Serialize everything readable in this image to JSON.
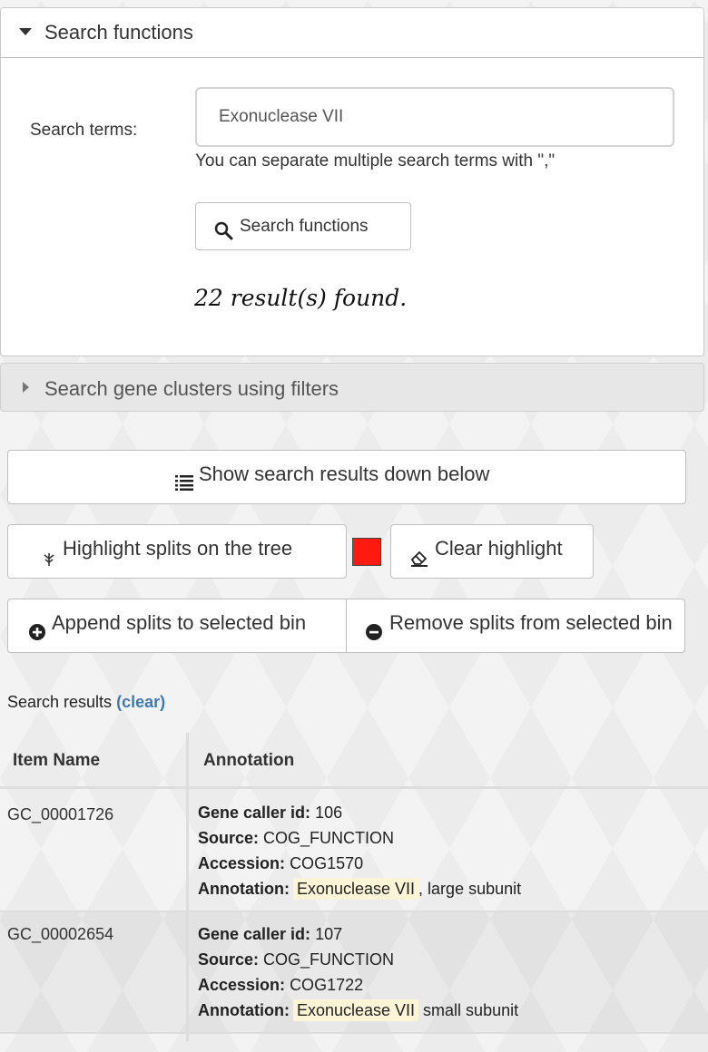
{
  "search_functions": {
    "title": "Search functions",
    "terms_label": "Search terms:",
    "terms_value": "Exonuclease VII",
    "hint": "You can separate multiple search terms with \",\"",
    "button_label": "Search functions",
    "results_found": "22 result(s) found."
  },
  "gene_clusters_panel": {
    "title": "Search gene clusters using filters"
  },
  "actions": {
    "show_results": "Show search results down below",
    "highlight_splits": "Highlight splits on the tree",
    "highlight_color": "#ff1a0f",
    "clear_highlight": "Clear highlight",
    "append_splits": "Append splits to selected bin",
    "remove_splits": "Remove splits from selected bin"
  },
  "results": {
    "heading": "Search results",
    "clear_link": "(clear)",
    "columns": [
      "Item Name",
      "Annotation"
    ],
    "field_labels": {
      "gene_caller_id": "Gene caller id:",
      "source": "Source:",
      "accession": "Accession:",
      "annotation": "Annotation:"
    },
    "rows": [
      {
        "item_name": "GC_00001726",
        "gene_caller_id": "106",
        "source": "COG_FUNCTION",
        "accession": "COG1570",
        "annotation_match": "Exonuclease VII",
        "annotation_rest": ", large subunit"
      },
      {
        "item_name": "GC_00002654",
        "gene_caller_id": "107",
        "source": "COG_FUNCTION",
        "accession": "COG1722",
        "annotation_match": "Exonuclease VII",
        "annotation_rest": " small subunit"
      }
    ]
  },
  "icons": {
    "search": "search-icon",
    "list": "list-icon",
    "tree": "tree-icon",
    "eraser": "eraser-icon",
    "plus": "plus-circle-icon",
    "minus": "minus-circle-icon"
  }
}
